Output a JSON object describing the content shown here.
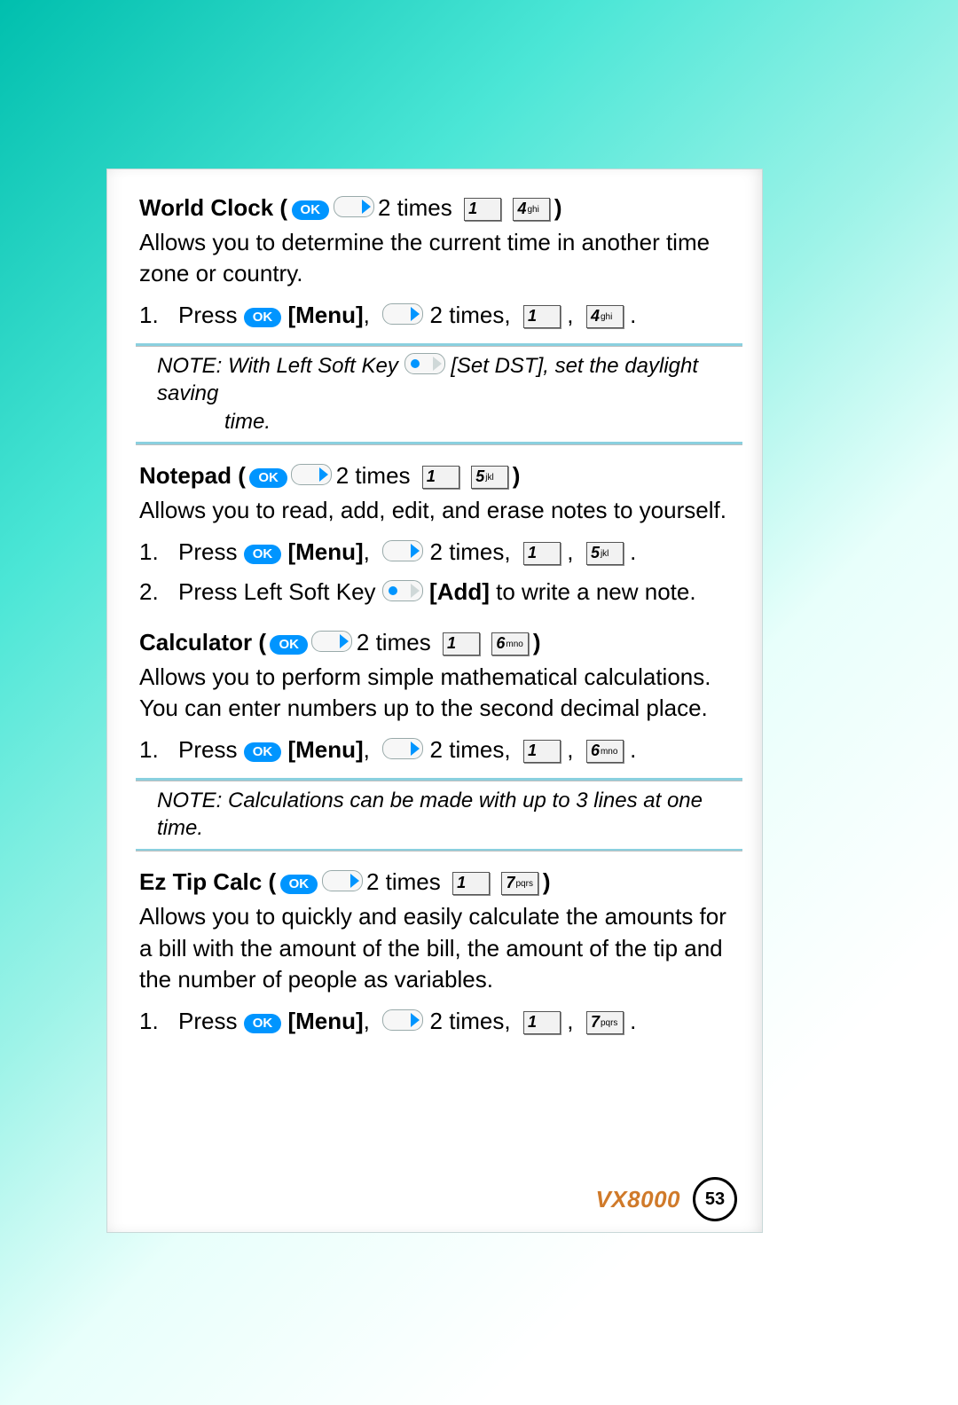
{
  "labels": {
    "ok": "OK",
    "menu": "[Menu]",
    "add": "[Add]",
    "two_times_bare": "2 times",
    "two_times_comma": "2 times,",
    "press": "Press"
  },
  "keys": {
    "k1": {
      "n": "1",
      "l": ""
    },
    "k4": {
      "n": "4",
      "l": "ghi"
    },
    "k5": {
      "n": "5",
      "l": "jkl"
    },
    "k6": {
      "n": "6",
      "l": "mno"
    },
    "k7": {
      "n": "7",
      "l": "pqrs"
    }
  },
  "world_clock": {
    "title": "World Clock (",
    "close": ")",
    "desc": "Allows you to determine the current time in another time zone or country.",
    "note_a": "NOTE: With Left Soft Key",
    "note_b": "[Set DST], set the daylight saving",
    "note_c": "time."
  },
  "notepad": {
    "title": "Notepad (",
    "close": ")",
    "desc": "Allows you to read, add, edit, and erase notes to yourself.",
    "step2_a": "Press Left Soft Key",
    "step2_b": "to write a new note."
  },
  "calculator": {
    "title": "Calculator (",
    "close": ")",
    "desc": "Allows you to perform simple mathematical calculations. You can enter numbers up to the second decimal place.",
    "note": "NOTE: Calculations can be made with up to 3 lines at one time."
  },
  "ez_tip": {
    "title": "Ez Tip Calc (",
    "close": ")",
    "desc": "Allows you to quickly and easily calculate the amounts for a bill with the amount of the bill, the amount of the tip and the number of people as variables."
  },
  "footer": {
    "model": "VX8000",
    "page": "53"
  }
}
